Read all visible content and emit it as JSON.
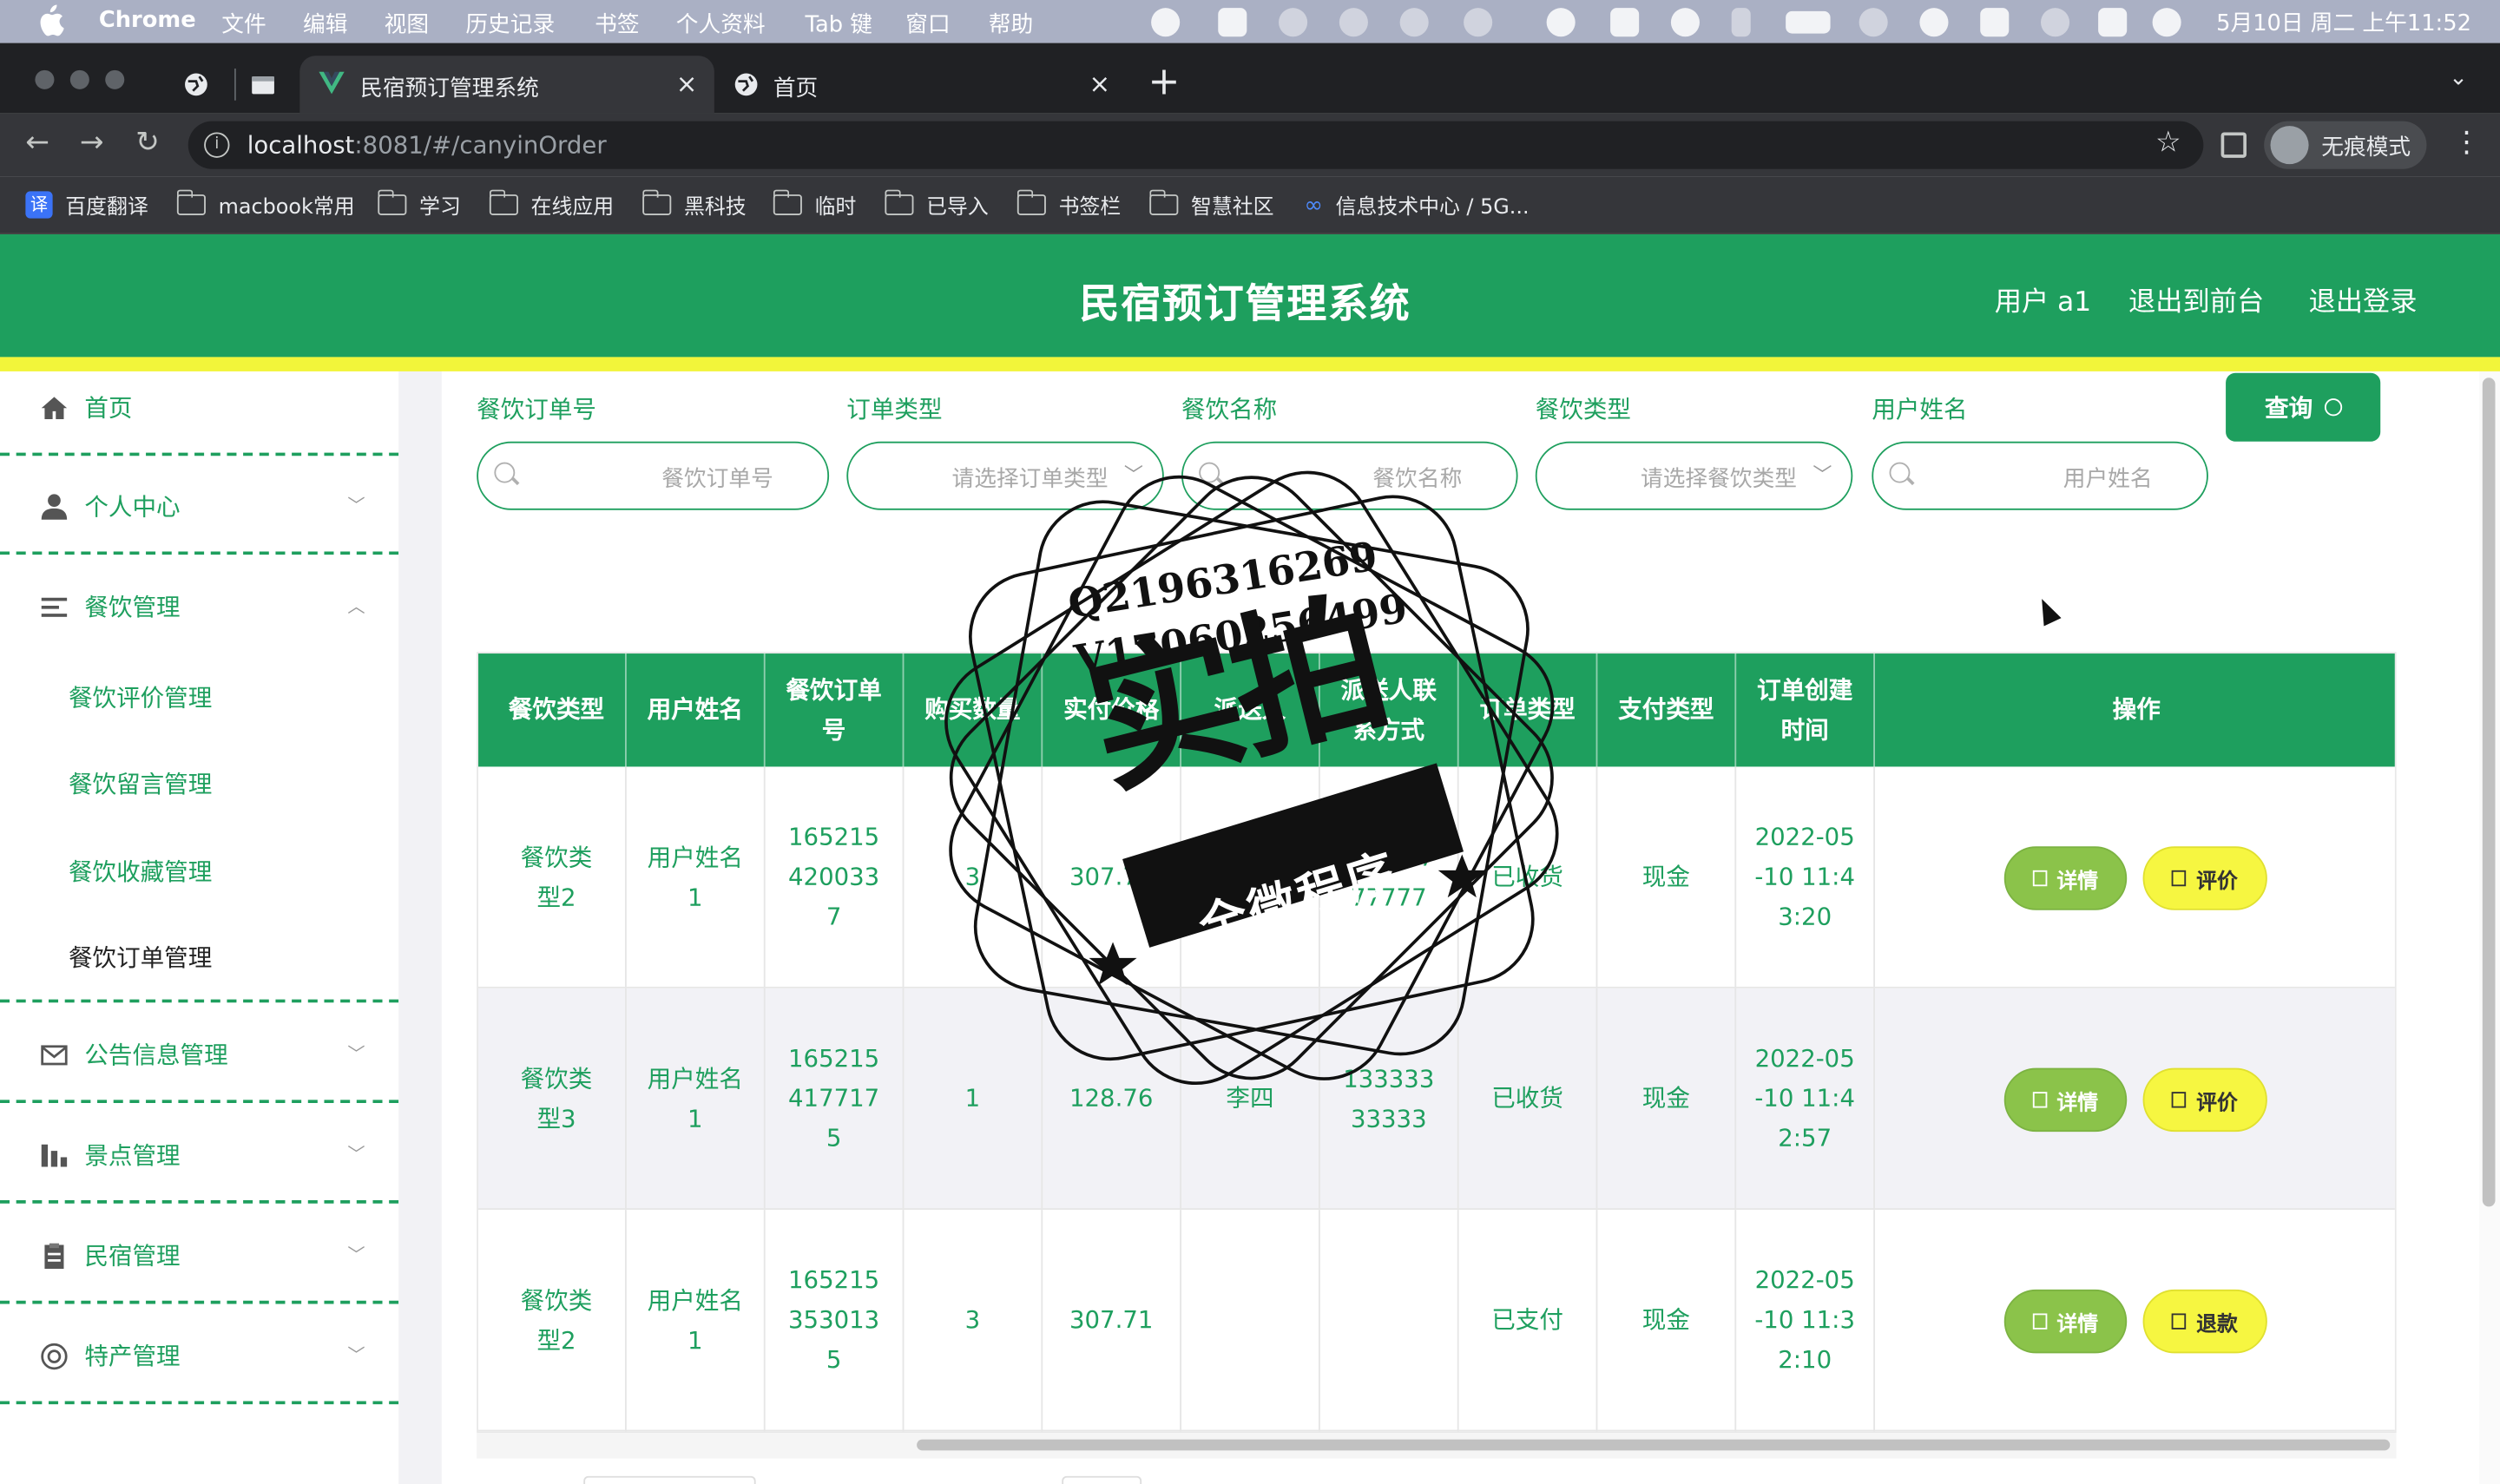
{
  "menubar": {
    "app": "Chrome",
    "items": [
      "文件",
      "编辑",
      "视图",
      "历史记录",
      "书签",
      "个人资料",
      "Tab 键",
      "窗口",
      "帮助"
    ],
    "clock": "5月10日 周二 上午11:52"
  },
  "tabs": [
    {
      "title": "民宿预订管理系统",
      "close": "×"
    },
    {
      "title": "首页",
      "close": "×"
    }
  ],
  "newtab": "+",
  "omnibox": {
    "host": "localhost",
    "path": ":8081/#/canyinOrder"
  },
  "incognito": "无痕模式",
  "bookmarks": [
    "百度翻译",
    "macbook常用",
    "学习",
    "在线应用",
    "黑科技",
    "临时",
    "已导入",
    "书签栏",
    "智慧社区",
    "信息技术中心 / 5G..."
  ],
  "translate_glyph": "译",
  "header": {
    "title": "民宿预订管理系统",
    "user": "用户 a1",
    "to_front": "退出到前台",
    "logout": "退出登录"
  },
  "sidebar": {
    "home": "首页",
    "personal": "个人中心",
    "catering": "餐饮管理",
    "sub": [
      "餐饮评价管理",
      "餐饮留言管理",
      "餐饮收藏管理",
      "餐饮订单管理"
    ],
    "notice": "公告信息管理",
    "scenic": "景点管理",
    "homestay": "民宿管理",
    "specialty": "特产管理"
  },
  "filters": {
    "order_no": {
      "label": "餐饮订单号",
      "placeholder": "餐饮订单号"
    },
    "order_type": {
      "label": "订单类型",
      "placeholder": "请选择订单类型"
    },
    "food_name": {
      "label": "餐饮名称",
      "placeholder": "餐饮名称"
    },
    "food_type": {
      "label": "餐饮类型",
      "placeholder": "请选择餐饮类型"
    },
    "user_name": {
      "label": "用户姓名",
      "placeholder": "用户姓名"
    },
    "query": "查询"
  },
  "table": {
    "headers": [
      "餐饮类型",
      "用户姓名",
      "餐饮订单号",
      "购买数量",
      "实付价格",
      "派送人",
      "派送人联系方式",
      "订单类型",
      "支付类型",
      "订单创建时间",
      "操作"
    ],
    "rows": [
      {
        "food_type": "餐饮类型2",
        "user": "用户姓名1",
        "order_no": "1652154200337",
        "qty": "3",
        "price": "307.71",
        "courier": "张三",
        "phone": "17777777777",
        "order_type": "已收货",
        "pay": "现金",
        "created": "2022-05-10 11:43:20",
        "btn1": "详情",
        "btn2": "评价"
      },
      {
        "food_type": "餐饮类型3",
        "user": "用户姓名1",
        "order_no": "1652154177175",
        "qty": "1",
        "price": "128.76",
        "courier": "李四",
        "phone": "13333333333",
        "order_type": "已收货",
        "pay": "现金",
        "created": "2022-05-10 11:42:57",
        "btn1": "详情",
        "btn2": "评价"
      },
      {
        "food_type": "餐饮类型2",
        "user": "用户姓名1",
        "order_no": "1652153530135",
        "qty": "3",
        "price": "307.71",
        "courier": "",
        "phone": "",
        "order_type": "已支付",
        "pay": "现金",
        "created": "2022-05-10 11:32:10",
        "btn1": "详情",
        "btn2": "退款"
      }
    ]
  },
  "watermark": {
    "line1": "Q2196316269",
    "line2": "V17060256499",
    "big": "实拍",
    "banner": "全微程序"
  },
  "colors": {
    "primary": "#1e9f5e",
    "accent_yellow": "#f2f53a",
    "detail_btn": "#8bc34a",
    "eval_btn": "#f6f641"
  }
}
